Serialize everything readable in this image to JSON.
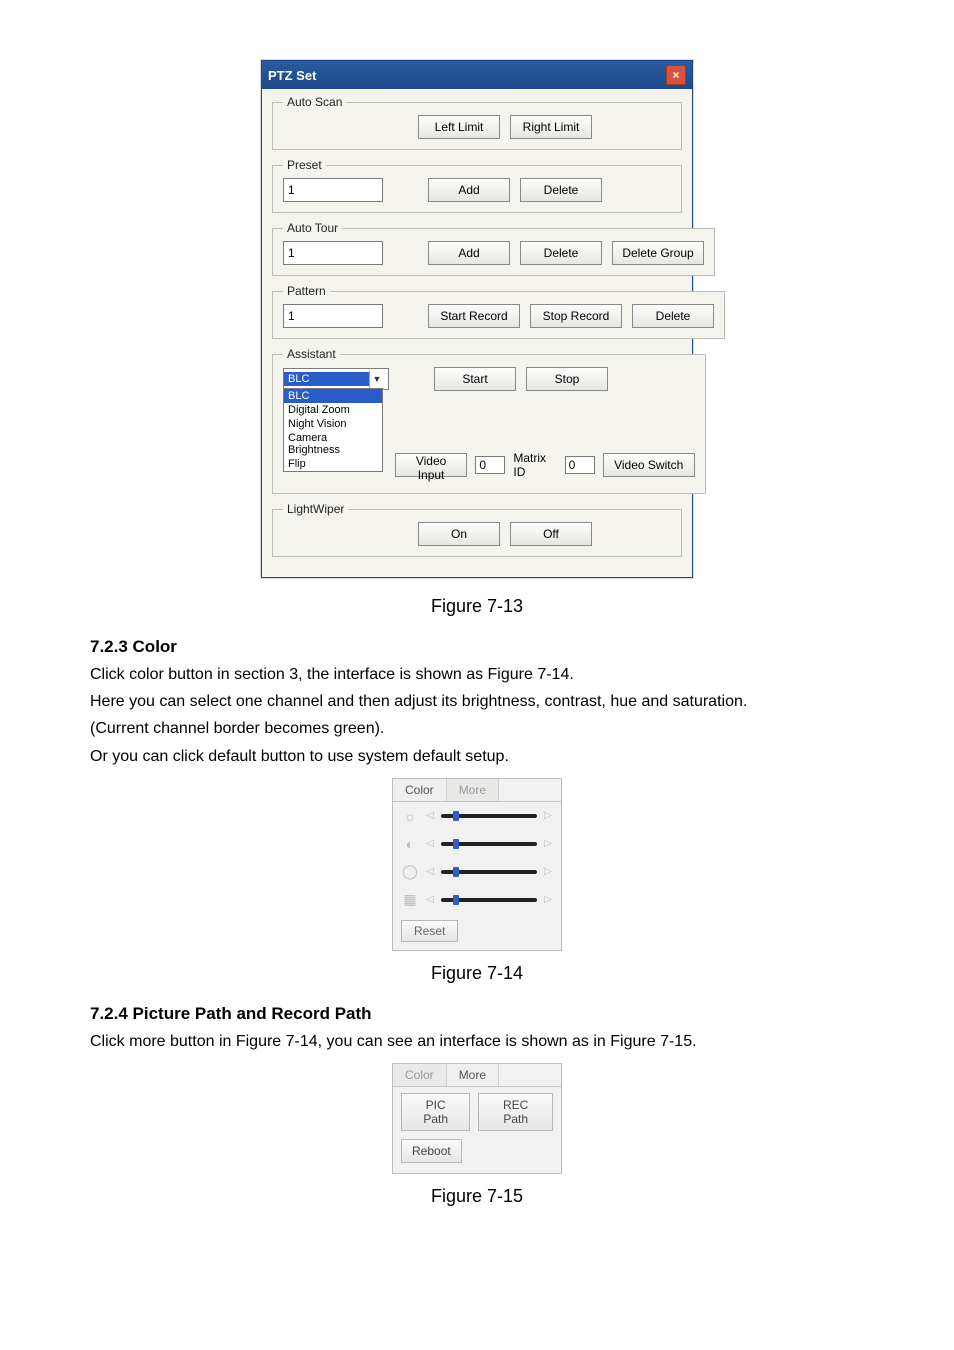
{
  "dialog": {
    "title": "PTZ Set",
    "close": "×",
    "autoscan": {
      "legend": "Auto Scan",
      "left": "Left Limit",
      "right": "Right Limit"
    },
    "preset": {
      "legend": "Preset",
      "value": "1",
      "add": "Add",
      "delete": "Delete"
    },
    "autotour": {
      "legend": "Auto Tour",
      "value": "1",
      "add": "Add",
      "delete": "Delete",
      "delgroup": "Delete Group"
    },
    "pattern": {
      "legend": "Pattern",
      "value": "1",
      "start": "Start Record",
      "stop": "Stop Record",
      "delete": "Delete"
    },
    "assistant": {
      "legend": "Assistant",
      "selected": "BLC",
      "options": [
        "BLC",
        "Digital Zoom",
        "Night Vision",
        "Camera Brightness",
        "Flip"
      ],
      "start": "Start",
      "stop": "Stop"
    },
    "matrix": {
      "videoinput_label": "Video Input",
      "videoinput_val": "0",
      "matrixid_label": "Matrix ID",
      "matrixid_val": "0",
      "switch": "Video Switch"
    },
    "lightwiper": {
      "legend": "LightWiper",
      "on": "On",
      "off": "Off"
    }
  },
  "figcaps": {
    "f13": "Figure 7-13",
    "f14": "Figure 7-14",
    "f15": "Figure 7-15"
  },
  "sections": {
    "color_heading": "7.2.3   Color",
    "color_p1": "Click color button in section 3, the interface is shown as Figure 7-14.",
    "color_p2": "Here you can select one channel and then adjust its brightness, contrast, hue and saturation.",
    "color_p3": "(Current channel border becomes green).",
    "color_p4": "Or you can click default button to use system default setup.",
    "path_heading": "7.2.4   Picture Path and Record Path",
    "path_p1": "Click more button in Figure 7-14, you can see an interface is shown as in Figure 7-15."
  },
  "color_panel": {
    "tab1": "Color",
    "tab2": "More",
    "reset": "Reset"
  },
  "more_panel": {
    "tab1": "Color",
    "tab2": "More",
    "pic": "PIC Path",
    "rec": "REC Path",
    "reboot": "Reboot"
  }
}
